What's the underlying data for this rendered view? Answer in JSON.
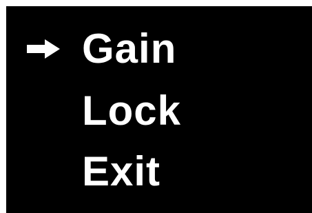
{
  "menu": {
    "items": [
      {
        "label": "Gain",
        "selected": true
      },
      {
        "label": "Lock",
        "selected": false
      },
      {
        "label": "Exit",
        "selected": false
      }
    ],
    "cursor_icon": "right-arrow-icon",
    "colors": {
      "screen_background": "#000000",
      "text": "#ffffff",
      "frame": "#ffffff"
    }
  }
}
